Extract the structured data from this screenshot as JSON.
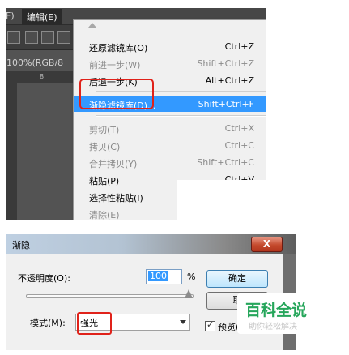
{
  "photoshop": {
    "menubar": {
      "left_fragment": "F)",
      "edit_menu": "编辑(E)"
    },
    "tab": {
      "label": "100%(RGB/8",
      "ruler_tick": "8"
    },
    "edit_menu": {
      "items": [
        {
          "label": "还原滤镜库(O)",
          "shortcut": "Ctrl+Z"
        },
        {
          "label": "前进一步(W)",
          "shortcut": "Shift+Ctrl+Z"
        },
        {
          "label": "后退一步(K)",
          "shortcut": "Alt+Ctrl+Z"
        },
        {
          "label": "渐隐滤镜库(D)...",
          "shortcut": "Shift+Ctrl+F"
        },
        {
          "label": "剪切(T)",
          "shortcut": "Ctrl+X"
        },
        {
          "label": "拷贝(C)",
          "shortcut": "Ctrl+C"
        },
        {
          "label": "合并拷贝(Y)",
          "shortcut": "Shift+Ctrl+C"
        },
        {
          "label": "粘贴(P)",
          "shortcut": "Ctrl+V"
        },
        {
          "label": "选择性粘贴(I)",
          "shortcut": ""
        },
        {
          "label": "清除(E)",
          "shortcut": ""
        }
      ]
    }
  },
  "fade_dialog": {
    "title": "渐隐",
    "close_label": "X",
    "opacity_label": "不透明度(O):",
    "opacity_value": "100",
    "percent_sign": "%",
    "slider_value": 1.0,
    "ok_label": "确定",
    "cancel_label": "取",
    "mode_label": "模式(M):",
    "mode_value": "强光",
    "preview_label": "预览(P",
    "preview_checked": true
  },
  "watermark": {
    "brand": "百科全说",
    "tagline": "助你轻松解决"
  },
  "colors": {
    "highlight": "#3399ff",
    "annotation": "#e0221a",
    "watermark": "#26a65b"
  }
}
